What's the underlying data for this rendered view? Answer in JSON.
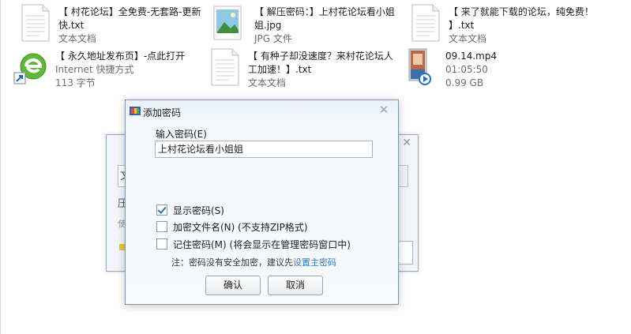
{
  "files": [
    {
      "name_line1": "【 村花论坛】全免费-无套路-更新",
      "name_line2": "快.txt",
      "type": "文本文档",
      "size": "",
      "icon": "text-document-icon"
    },
    {
      "name_line1": "【 解压密码：】上村花论坛看小姐",
      "name_line2": "姐.jpg",
      "type": "JPG 文件",
      "size": "",
      "icon": "image-file-icon"
    },
    {
      "name_line1": "【 来了就能下载的论坛，纯免费！",
      "name_line2": "】.txt",
      "type": "文本文档",
      "size": "",
      "icon": "text-document-icon"
    },
    {
      "name_line1": "【 永久地址发布页】-点此打开",
      "name_line2": "",
      "type": "Internet 快捷方式",
      "size": "113 字节",
      "icon": "internet-shortcut-icon"
    },
    {
      "name_line1": "【 有种子却没速度？来村花论坛人",
      "name_line2": "工加速！】.txt",
      "type": "文本文档",
      "size": "",
      "icon": "text-document-icon"
    },
    {
      "name_line1": "09.14.mp4",
      "name_line2": "",
      "type": "01:05:50",
      "size": "0.99 GB",
      "icon": "video-file-icon"
    }
  ],
  "bg_dialog": {
    "text1": "文",
    "text2": "压",
    "text3": "使"
  },
  "dialog": {
    "title": "添加密码",
    "password_label": "输入密码(E)",
    "password_value": "上村花论坛看小姐姐",
    "checkboxes": [
      {
        "label": "显示密码(S)",
        "checked": true
      },
      {
        "label": "加密文件名(N) (不支持ZIP格式)",
        "checked": false
      },
      {
        "label": "记住密码(M) (将会显示在管理密码窗口中)",
        "checked": false
      }
    ],
    "note_prefix": "注：密码没有安全加密，建议先",
    "note_link": "设置主密码",
    "ok_label": "确认",
    "cancel_label": "取消"
  },
  "colors": {
    "accent": "#2f7bd1",
    "check": "#2a6ebd"
  }
}
